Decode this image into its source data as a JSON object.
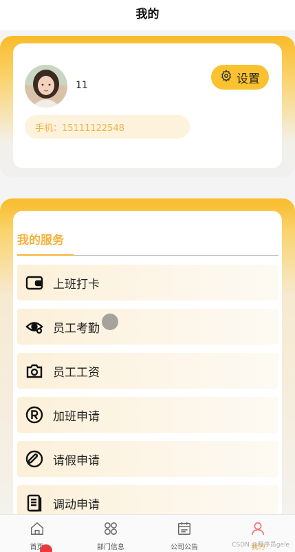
{
  "header": {
    "title": "我的"
  },
  "profile": {
    "username": "11",
    "settings_label": "设置",
    "phone_text": "手机：15111122548"
  },
  "services": {
    "title": "我的服务",
    "items": [
      {
        "label": "上班打卡",
        "icon": "wallet-icon"
      },
      {
        "label": "员工考勤",
        "icon": "eye-icon"
      },
      {
        "label": "员工工资",
        "icon": "camera-icon"
      },
      {
        "label": "加班申请",
        "icon": "registered-icon"
      },
      {
        "label": "请假申请",
        "icon": "pen-circle-icon"
      },
      {
        "label": "调动申请",
        "icon": "document-icon"
      }
    ]
  },
  "tabbar": {
    "items": [
      {
        "label": "首页",
        "icon": "home-icon",
        "active": false
      },
      {
        "label": "部门信息",
        "icon": "grid-icon",
        "active": false
      },
      {
        "label": "公司公告",
        "icon": "calendar-icon",
        "active": false
      },
      {
        "label": "我的",
        "icon": "user-icon",
        "active": true
      }
    ]
  },
  "watermark": "CSDN @程序员gele",
  "colors": {
    "accent": "#f9c22e",
    "accent_text": "#f5b23a",
    "active_tab": "#f0707a"
  }
}
